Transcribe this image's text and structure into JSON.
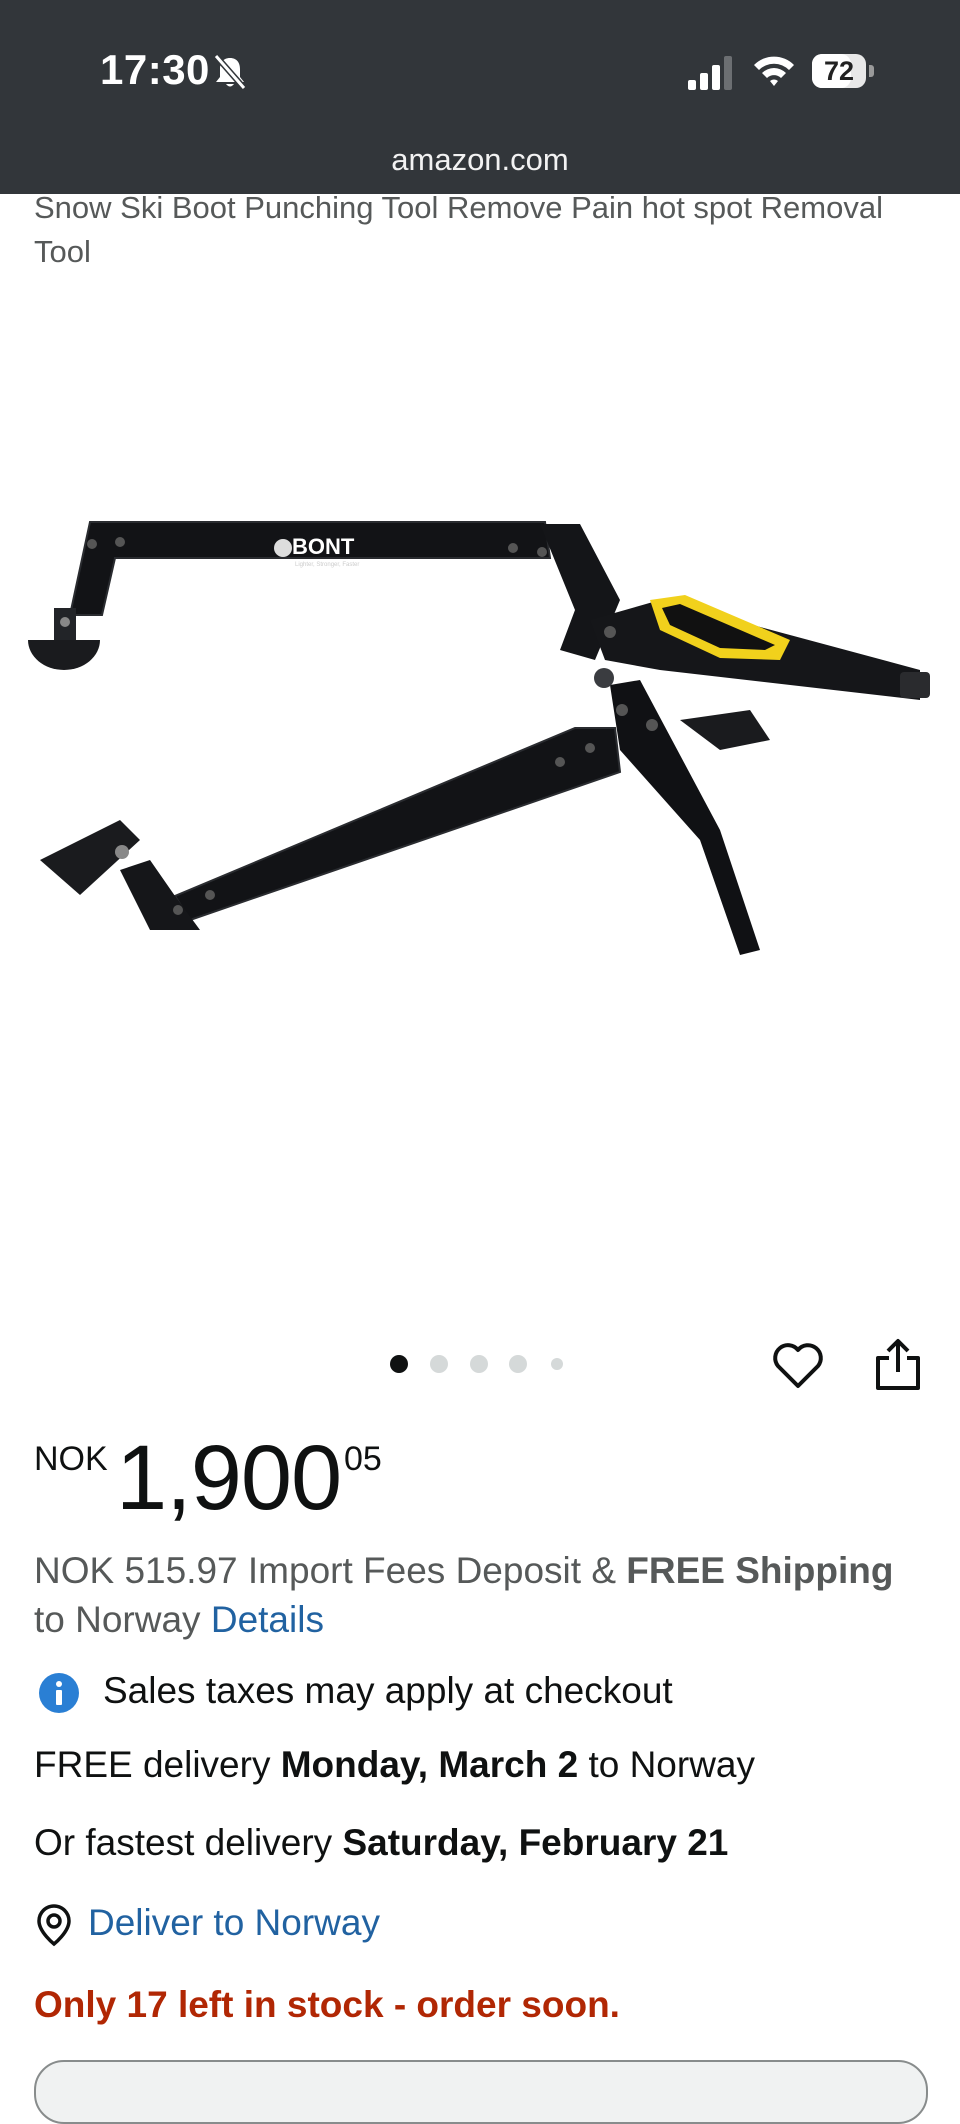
{
  "status_bar": {
    "time": "17:30",
    "battery": "72",
    "battery_level": 0.72
  },
  "browser": {
    "url": "amazon.com"
  },
  "product": {
    "title": "Snow Ski Boot Punching Tool Remove Pain hot spot Removal Tool",
    "image_brand_text": "BONT",
    "image_tagline": "Lighter, Stronger, Faster",
    "image_count": 5,
    "active_image": 1
  },
  "price": {
    "currency": "NOK",
    "whole": "1,900",
    "fraction": "05"
  },
  "fees": {
    "text_a": "NOK 515.97 Import Fees Deposit & ",
    "bold_a": "FREE Shipping",
    "text_b": " to Norway ",
    "details_link": "Details"
  },
  "tax_notice": "Sales taxes may apply at checkout",
  "delivery": {
    "free_prefix": "FREE delivery ",
    "free_date": "Monday, March 2",
    "free_suffix": " to Norway",
    "fast_prefix": "Or fastest delivery ",
    "fast_date": "Saturday, February 21"
  },
  "deliver_to": "Deliver to Norway",
  "stock": "Only 17 left in stock - order soon.",
  "icons": {
    "bell": "bell-slash-icon",
    "signal": "cellular-signal-icon",
    "wifi": "wifi-icon",
    "heart": "heart-icon",
    "share": "share-icon",
    "info": "info-icon",
    "pin": "location-pin-icon"
  },
  "colors": {
    "topbar": "#32363a",
    "link": "#2162a1",
    "stock": "#b12704",
    "info_icon": "#2a7fd4",
    "clamp_accent": "#f1d11c"
  }
}
